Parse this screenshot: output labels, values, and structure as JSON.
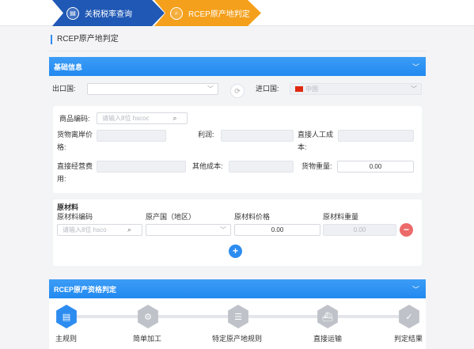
{
  "tabs": [
    {
      "label": "关税税率查询",
      "icon": "tariff-doc-icon"
    },
    {
      "label": "RCEP原产地判定",
      "icon": "search-globe-icon"
    }
  ],
  "page_title": "RCEP原产地判定",
  "basic": {
    "title": "基础信息",
    "export_label": "出口国:",
    "export_value": "",
    "import_label": "进口国:",
    "import_value": "中国",
    "product_code_label": "商品编码:",
    "product_code_placeholder": "请输入8位 hscoc",
    "fob_label_1": "货物离岸价",
    "fob_label_2": "格:",
    "profit_label": "利润:",
    "labor_label_1": "直接人工成",
    "labor_label_2": "本:",
    "overhead_label_1": "直接经营费",
    "overhead_label_2": "用:",
    "other_label": "其他成本:",
    "weight_label": "货物重量:",
    "weight_value": "0.00"
  },
  "materials": {
    "title": "原材料",
    "col_code": "原材料编码",
    "col_origin": "原产国（地区）",
    "col_price": "原材料价格",
    "col_weight": "原材料重量",
    "code_placeholder": "请输入8位 hsco",
    "price_value": "0.00",
    "weight_value": "0.00",
    "remove_glyph": "−",
    "add_glyph": "+"
  },
  "rcep": {
    "title": "RCEP原产资格判定",
    "steps": [
      "主规则",
      "简单加工",
      "特定原产地规则",
      "直接运输",
      "判定结果"
    ]
  },
  "colors": {
    "primary": "#2d8cf0",
    "orange": "#f4a01c",
    "navy": "#1f58b5",
    "danger": "#ec6a6a"
  }
}
